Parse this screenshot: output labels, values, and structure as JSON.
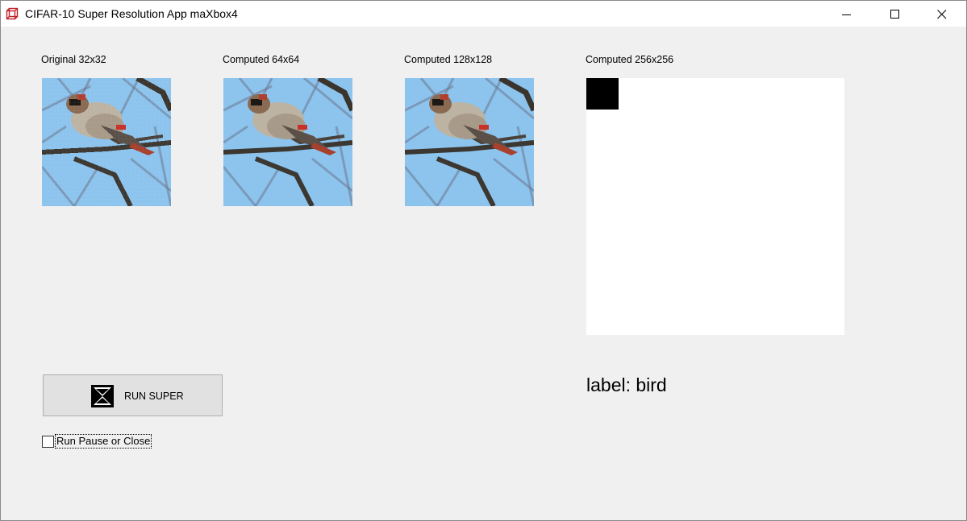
{
  "window": {
    "title": "CIFAR-10 Super Resolution App maXbox4",
    "app_icon": "cube-outline-icon",
    "controls": [
      "minimize-icon",
      "maximize-icon",
      "close-icon"
    ]
  },
  "panels": [
    {
      "label": "Original 32x32",
      "image": "bird-32-thumbnail"
    },
    {
      "label": "Computed 64x64",
      "image": "bird-64-thumbnail"
    },
    {
      "label": "Computed 128x128",
      "image": "bird-128-thumbnail"
    },
    {
      "label": "Computed 256x256",
      "image": "blank-canvas"
    }
  ],
  "run_button": {
    "label": "RUN SUPER",
    "icon": "hourglass-icon"
  },
  "checkbox": {
    "label": "Run Pause or Close",
    "checked": false
  },
  "result": {
    "text": "label: bird"
  },
  "colors": {
    "sky": "#8cc4ee",
    "window_bg": "#f0f0f0",
    "titlebar_bg": "#ffffff",
    "button_bg": "#e1e1e1"
  }
}
